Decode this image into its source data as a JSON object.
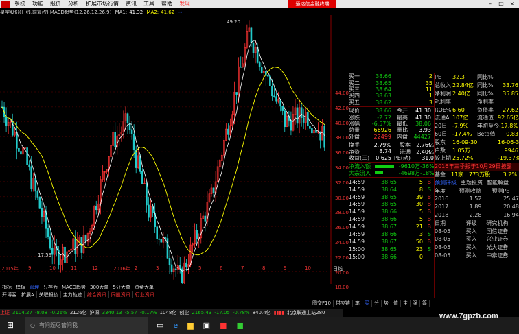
{
  "menu": {
    "items": [
      "系统",
      "功能",
      "报价",
      "分析",
      "扩展市场行情",
      "资讯",
      "工具",
      "帮助"
    ],
    "highlight": "发现",
    "promo": "通达信金融终端"
  },
  "info": {
    "title": "星宇股份(日线,前复权) MACD趋势(12,26,12,26,9)",
    "ma1_label": "MA1:",
    "ma1": "41.32",
    "ma2_label": "MA2:",
    "ma2": "41.62",
    "extra": "→"
  },
  "y_ticks": [
    "44.00",
    "42.00",
    "40.00",
    "38.00",
    "36.00",
    "34.00",
    "32.00",
    "30.00",
    "28.00",
    "26.00",
    "24.00",
    "22.00",
    "20.00",
    "18.00"
  ],
  "x_ticks": [
    "2015年",
    "9",
    "10",
    "11",
    "12",
    "2016年",
    "2",
    "3",
    "4",
    "5",
    "6",
    "7",
    "8",
    "9",
    "10",
    "日线"
  ],
  "chart_labels": {
    "high": "49.20",
    "low": "17.59"
  },
  "quote": {
    "bids": [
      {
        "label": "买一",
        "price": "38.66",
        "vol": "2"
      },
      {
        "label": "买二",
        "price": "38.65",
        "vol": "35"
      },
      {
        "label": "买三",
        "price": "38.64",
        "vol": "11"
      },
      {
        "label": "买四",
        "price": "38.63",
        "vol": "1"
      },
      {
        "label": "买五",
        "price": "38.62",
        "vol": "3"
      }
    ],
    "stats": [
      {
        "l1": "现价",
        "v1": "38.66",
        "l2": "今开",
        "v2": "41.30"
      },
      {
        "l1": "涨跌",
        "v1": "-2.72",
        "l2": "最高",
        "v2": "41.30"
      },
      {
        "l1": "涨幅",
        "v1": "-6.57%",
        "l2": "最低",
        "v2": "38.06"
      },
      {
        "l1": "总量",
        "v1": "66926",
        "l2": "量比",
        "v2": "3.93"
      },
      {
        "l1": "外盘",
        "v1": "22499",
        "l2": "内盘",
        "v2": "44427"
      }
    ],
    "stats2": [
      {
        "l1": "换手",
        "v1": "2.79%",
        "l2": "股本",
        "v2": "2.76亿"
      },
      {
        "l1": "净资",
        "v1": "8.74",
        "l2": "流通",
        "v2": "2.40亿"
      },
      {
        "l1": "收益(三)",
        "v1": "0.625",
        "l2": "PE(动)",
        "v2": "31.0"
      }
    ],
    "flows": [
      {
        "label": "净流入额",
        "value": "-9610万",
        "pct": "-36%"
      },
      {
        "label": "大宗流入",
        "value": "-4698万",
        "pct": "-18%"
      }
    ],
    "ticks": [
      {
        "t": "14:59",
        "p": "38.65",
        "v": "5",
        "d": "B"
      },
      {
        "t": "14:59",
        "p": "38.64",
        "v": "8",
        "d": "S"
      },
      {
        "t": "14:59",
        "p": "38.65",
        "v": "39",
        "d": "B"
      },
      {
        "t": "14:59",
        "p": "38.65",
        "v": "30",
        "d": "B"
      },
      {
        "t": "14:59",
        "p": "38.66",
        "v": "5",
        "d": "B"
      },
      {
        "t": "14:59",
        "p": "38.66",
        "v": "5",
        "d": "B"
      },
      {
        "t": "14:59",
        "p": "38.67",
        "v": "21",
        "d": "B"
      },
      {
        "t": "14:59",
        "p": "38.66",
        "v": "3",
        "d": "S"
      },
      {
        "t": "14:59",
        "p": "38.67",
        "v": "50",
        "d": "B"
      },
      {
        "t": "15:00",
        "p": "38.65",
        "v": "23",
        "d": "S"
      },
      {
        "t": "15:00",
        "p": "38.66",
        "v": "0",
        "d": ""
      }
    ]
  },
  "right": {
    "rows": [
      {
        "a": "PE",
        "b": "32.3",
        "c": "同比%",
        "d": ""
      },
      {
        "a": "总收入",
        "b": "22.84亿",
        "c": "同比%",
        "d": "33.76"
      },
      {
        "a": "净利润",
        "b": "2.40亿",
        "c": "同比%",
        "d": "35.85"
      },
      {
        "a": "毛利率",
        "b": "",
        "c": "净利率",
        "d": ""
      },
      {
        "a": "ROE%",
        "b": "6.60",
        "c": "负债率",
        "d": "27.62"
      },
      {
        "a": "流通A",
        "b": "107亿",
        "c": "流通值",
        "d": "92.65亿"
      },
      {
        "a": "20日",
        "b": "-7.9%",
        "c": "年初至今",
        "d": "-17.8%"
      },
      {
        "a": "60日",
        "b": "-17.4%",
        "c": "Beta值",
        "d": "0.83"
      },
      {
        "a": "股东",
        "b": "16-09-30",
        "c": "",
        "d": "16-06-30"
      },
      {
        "a": "户数",
        "b": "1.05万",
        "c": "",
        "d": "9946"
      },
      {
        "a": "较上期",
        "b": "25.72%",
        "c": "",
        "d": "-19.37%"
      }
    ],
    "notice": "2016年三季报于10月29日披露",
    "fund": {
      "a": "基金",
      "b": "11家",
      "c": "773万股",
      "d": "3.2%"
    },
    "tabs": [
      "预测评级",
      "主题投资",
      "智能解盘"
    ],
    "forecast_header": [
      "年度",
      "预测收益",
      "预测PE"
    ],
    "forecast": [
      {
        "y": "2016",
        "e": "1.52",
        "pe": "25.47"
      },
      {
        "y": "2017",
        "e": "1.89",
        "pe": "20.48"
      },
      {
        "y": "2018",
        "e": "2.28",
        "pe": "16.94"
      }
    ],
    "rating_header": [
      "日期",
      "评级",
      "研究机构"
    ],
    "ratings": [
      {
        "d": "08-05",
        "r": "买入",
        "o": "国信证券"
      },
      {
        "d": "08-05",
        "r": "买入",
        "o": "兴业证券"
      },
      {
        "d": "08-05",
        "r": "买入",
        "o": "光大证券"
      },
      {
        "d": "08-05",
        "r": "买入",
        "o": "中泰证券"
      }
    ]
  },
  "tabs": [
    "指标",
    "模板",
    "管理",
    "只存为",
    "MACD趋势",
    "300大单",
    "5分大单",
    "资金大单"
  ],
  "tabs2": [
    "开博客",
    "扩展A",
    "关联报价",
    "主力轨迹",
    "综合资讯",
    "同股资讯",
    "行业资讯"
  ],
  "bottom_tabs": [
    "图交F10",
    "供应链",
    "笔",
    "买",
    "分",
    "势",
    "值",
    "主",
    "强",
    "筹"
  ],
  "status": {
    "sh_label": "上证",
    "sh": "3104.27",
    "sh_chg": "-8.08",
    "sh_pct": "-0.26%",
    "sh_vol": "2126亿",
    "sz_label": "沪深",
    "sz": "3340.13",
    "sz_chg": "-5.57",
    "sz_pct": "-0.17%",
    "sz_vol": "1048亿",
    "cy_label": "创业",
    "cy": "2165.43",
    "cy_chg": "-17.05",
    "cy_pct": "-0.78%",
    "cy_vol": "840.4亿",
    "server": "北京联通主站280"
  },
  "taskbar": {
    "search": "有问题尽管问我"
  },
  "watermark": "www.7gpzb.com",
  "colors": {
    "up": "#ff3333",
    "down": "#22cc22",
    "ma1": "#ffffff",
    "ma2": "#ffff00",
    "red_line": "#ff0000",
    "blue_line": "#3060ff"
  }
}
